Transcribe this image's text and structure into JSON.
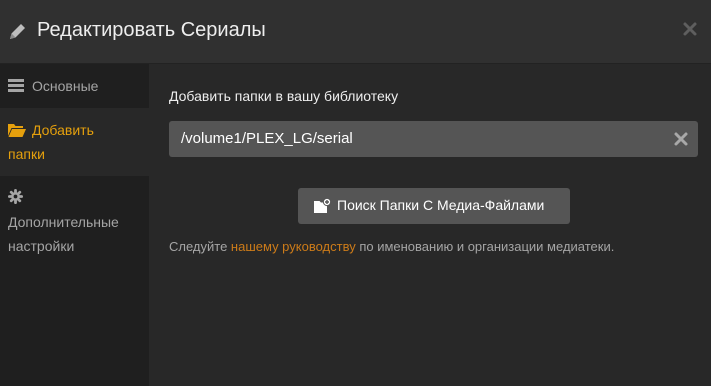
{
  "header": {
    "title": "Редактировать Сериалы",
    "icon": "pencil-icon",
    "close_icon": "close-icon"
  },
  "sidebar": {
    "items": [
      {
        "label": "Основные",
        "icon": "library-icon",
        "active": false
      },
      {
        "label": "Добавить папки",
        "icon": "folder-open-icon",
        "active": true
      },
      {
        "label": "Дополнительные настройки",
        "icon": "gear-icon",
        "active": false
      }
    ]
  },
  "main": {
    "section_title": "Добавить папки в вашу библиотеку",
    "folders": [
      {
        "path": "/volume1/PLEX_LG/serial"
      }
    ],
    "browse_button": "Поиск Папки С Медиа-Файлами",
    "help_text": {
      "before": "Следуйте ",
      "link": "нашему руководству",
      "after": " по именованию и организации медиатеки."
    }
  },
  "colors": {
    "accent": "#e5a00d",
    "link": "#cc7b19",
    "header_bg": "#303030",
    "content_bg": "#282828",
    "sidebar_bg": "#1f1f1f",
    "input_bg": "#555555"
  }
}
